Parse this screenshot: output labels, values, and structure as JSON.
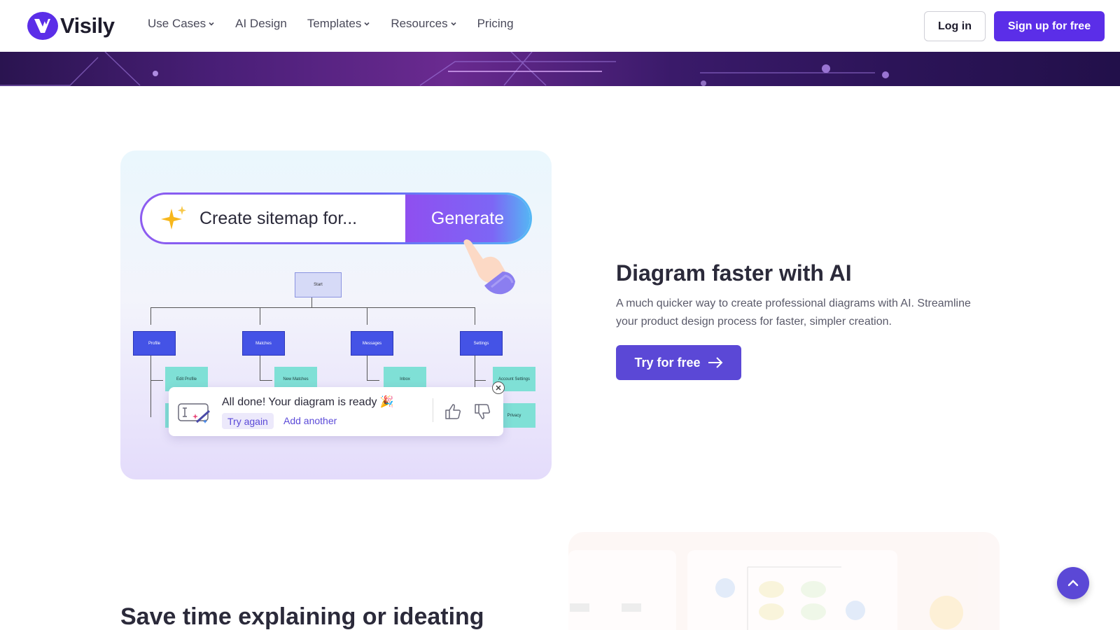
{
  "brand": {
    "name": "Visily",
    "accent": "#5b2ee8"
  },
  "nav": {
    "items": [
      {
        "label": "Use Cases",
        "dropdown": true
      },
      {
        "label": "AI Design",
        "dropdown": false
      },
      {
        "label": "Templates",
        "dropdown": true
      },
      {
        "label": "Resources",
        "dropdown": true
      },
      {
        "label": "Pricing",
        "dropdown": false
      }
    ],
    "login_label": "Log in",
    "signup_label": "Sign up for free"
  },
  "demo": {
    "prompt_text": "Create sitemap for...",
    "generate_label": "Generate",
    "tree": {
      "root": "Start",
      "children": [
        "Profile",
        "Matches",
        "Messages",
        "Settings"
      ],
      "leaves": [
        "Edit Profile",
        "New Matches",
        "Inbox",
        "Account Settings",
        "Privacy"
      ]
    },
    "toast": {
      "title": "All done! Your diagram is ready",
      "emoji": "🎉",
      "try_again": "Try again",
      "add_another": "Add another"
    }
  },
  "feature": {
    "title": "Diagram faster with AI",
    "description": "A much quicker way to create professional diagrams with AI. Streamline your product design process for faster, simpler creation.",
    "cta_label": "Try for free"
  },
  "section2": {
    "title": "Save time explaining or ideating"
  }
}
